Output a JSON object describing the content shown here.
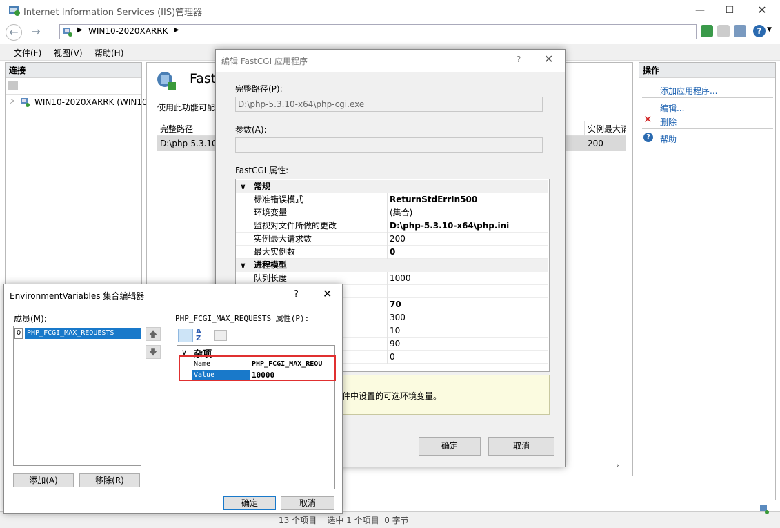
{
  "window": {
    "title": "Internet Information Services (IIS)管理器"
  },
  "address": {
    "path": "WIN10-2020XARRK"
  },
  "menu": {
    "file": "文件(F)",
    "view": "视图(V)",
    "help": "帮助(H)"
  },
  "connections": {
    "header": "连接",
    "tree_item": "WIN10-2020XARRK (WIN10"
  },
  "center": {
    "title": "Fast",
    "description": "使用此功能可配",
    "col_path": "完整路径",
    "col_max": "实例最大请",
    "row_path": "D:\\php-5.3.10",
    "row_max": "200"
  },
  "actions": {
    "header": "操作",
    "add_app": "添加应用程序...",
    "edit": "编辑...",
    "delete": "删除",
    "help": "帮助"
  },
  "fastcgi_dialog": {
    "title": "编辑 FastCGI 应用程序",
    "help_mark": "?",
    "full_path_label": "完整路径(P):",
    "full_path_value": "D:\\php-5.3.10-x64\\php-cgi.exe",
    "args_label": "参数(A):",
    "args_value": "",
    "props_label": "FastCGI 属性:",
    "cat_general": "常规",
    "cat_process": "进程模型",
    "rows": [
      {
        "name": "标准错误模式",
        "value": "ReturnStdErrIn500"
      },
      {
        "name": "环境变量",
        "value": "(集合)"
      },
      {
        "name": "监视对文件所做的更改",
        "value": "D:\\php-5.3.10-x64\\php.ini"
      },
      {
        "name": "实例最大请求数",
        "value": "200"
      },
      {
        "name": "最大实例数",
        "value": "0"
      },
      {
        "name": "队列长度",
        "value": "1000"
      },
      {
        "name": "",
        "value": ""
      },
      {
        "name": "",
        "value": "70"
      },
      {
        "name": "",
        "value": "300"
      },
      {
        "name": "",
        "value": "10"
      },
      {
        "name": "",
        "value": "90"
      },
      {
        "name": "",
        "value": "0"
      }
    ],
    "description": "件中设置的可选环境变量。",
    "ok": "确定",
    "cancel": "取消"
  },
  "env_dialog": {
    "title": "EnvironmentVariables 集合编辑器",
    "help_mark": "?",
    "members_label": "成员(M):",
    "member_index": "0",
    "member_name": "PHP_FCGI_MAX_REQUESTS",
    "props_label": "PHP_FCGI_MAX_REQUESTS 属性(P):",
    "category": "杂项",
    "prop_name_key": "Name",
    "prop_name_value": "PHP_FCGI_MAX_REQU",
    "prop_value_key": "Value",
    "prop_value_value": "10000",
    "add": "添加(A)",
    "remove": "移除(R)",
    "ok": "确定",
    "cancel": "取消"
  },
  "statusbar": {
    "text": "13 个项目    选中 1 个项目  0 字节"
  },
  "colors": {
    "highlight": "#1979ca",
    "red_box": "#e03030",
    "info_bg": "#fbfbe0"
  }
}
